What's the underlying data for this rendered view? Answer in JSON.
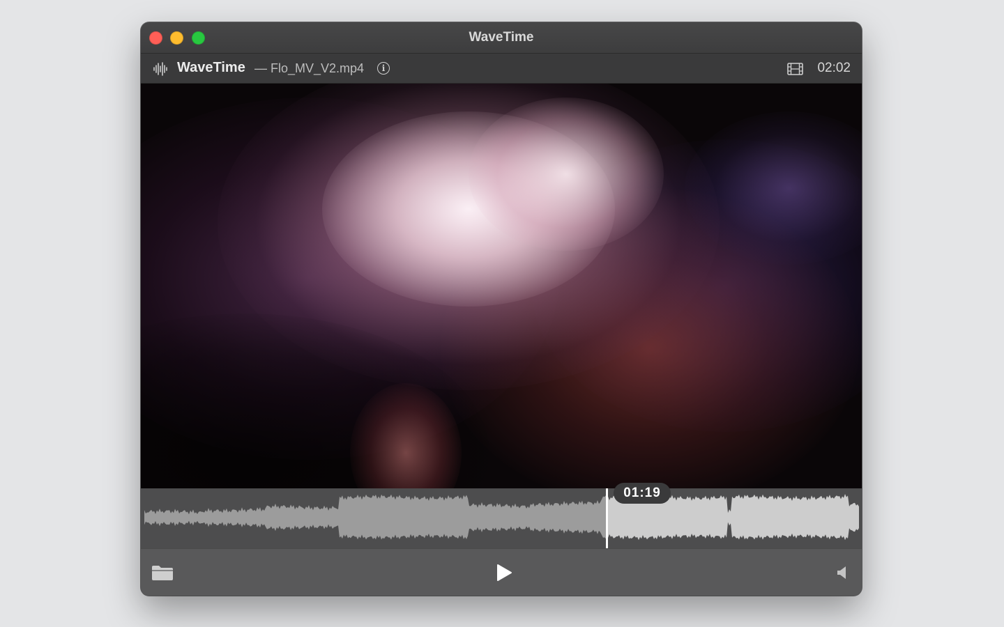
{
  "window": {
    "title": "WaveTime"
  },
  "toolbar": {
    "app_name": "WaveTime",
    "file_name": "— Flo_MV_V2.mp4",
    "duration": "02:02",
    "icons": [
      "waveform-icon",
      "info-icon",
      "film-icon"
    ]
  },
  "timeline": {
    "current_time": "01:19",
    "progress": 0.647
  },
  "controls": {
    "icons": [
      "folder-icon",
      "play-icon",
      "volume-icon"
    ]
  },
  "colors": {
    "close": "#ff5f57",
    "minimize": "#febc2e",
    "maximize": "#28c840",
    "waveform_played": "#9c9c9c",
    "waveform_unplayed": "#cdcdcd",
    "playhead": "#ffffff"
  }
}
